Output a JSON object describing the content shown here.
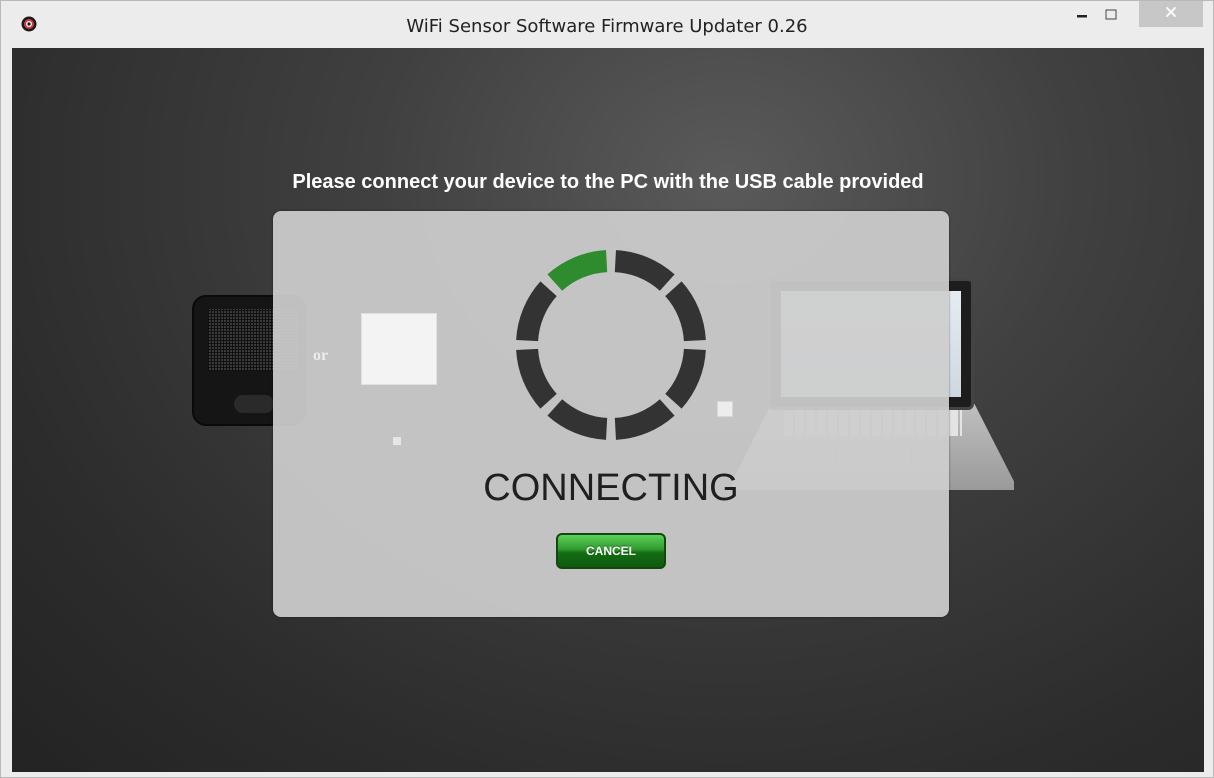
{
  "window": {
    "title": "WiFi Sensor Software Firmware Updater 0.26",
    "controls": {
      "minimize_icon": "minimize-icon",
      "maximize_icon": "maximize-icon",
      "close_icon": "close-icon"
    }
  },
  "main": {
    "instruction": "Please connect your device to the PC with the USB cable provided",
    "illustration": {
      "separator_text": "or"
    }
  },
  "dialog": {
    "status": "CONNECTING",
    "cancel_label": "CANCEL",
    "spinner": {
      "segments": 8,
      "active_segment": 0,
      "active_color": "#2e8b2e",
      "inactive_color": "#333333"
    }
  },
  "colors": {
    "accent": "#2e8b2e",
    "background": "#2e2e2e",
    "overlay": "#cdcdcd"
  }
}
